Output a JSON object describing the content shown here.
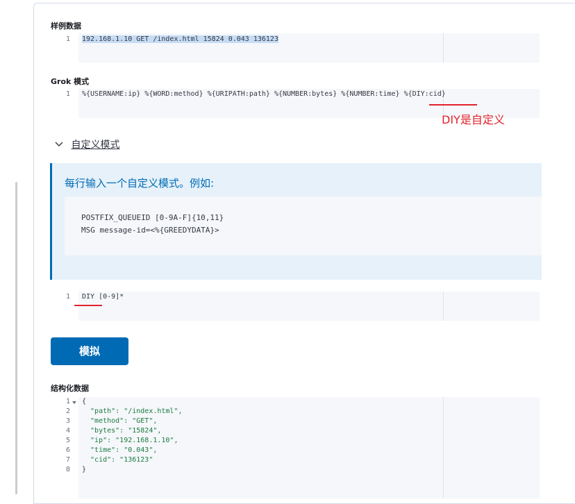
{
  "sample": {
    "label": "样例数据",
    "lines": [
      "192.168.1.10 GET /index.html 15824 0.043 136123"
    ]
  },
  "grok": {
    "label": "Grok 模式",
    "lines": [
      "%{USERNAME:ip} %{WORD:method} %{URIPATH:path} %{NUMBER:bytes} %{NUMBER:time} %{DIY:cid}"
    ]
  },
  "annotation": {
    "text": "DIY是自定义"
  },
  "custom": {
    "toggle_label": "自定义模式",
    "help_title": "每行输入一个自定义模式。例如:",
    "help_example": [
      "POSTFIX_QUEUEID [0-9A-F]{10,11}",
      "MSG message-id=<%{GREEDYDATA}>"
    ],
    "lines": [
      "DIY [0-9]*"
    ]
  },
  "simulate_button": "模拟",
  "structured": {
    "label": "结构化数据",
    "lines": [
      "{",
      "  \"path\": \"/index.html\",",
      "  \"method\": \"GET\",",
      "  \"bytes\": \"15824\",",
      "  \"ip\": \"192.168.1.10\",",
      "  \"time\": \"0.043\",",
      "  \"cid\": \"136123\"",
      "}"
    ]
  },
  "line_numbers": [
    "1",
    "2",
    "3",
    "4",
    "5",
    "6",
    "7",
    "8"
  ],
  "colors": {
    "accent": "#006bb4",
    "annotation": "#e2232a",
    "selection": "#c6dcf5"
  },
  "icons": {
    "accordion": "chevron-down-icon",
    "fold": "fold-arrow-icon"
  }
}
